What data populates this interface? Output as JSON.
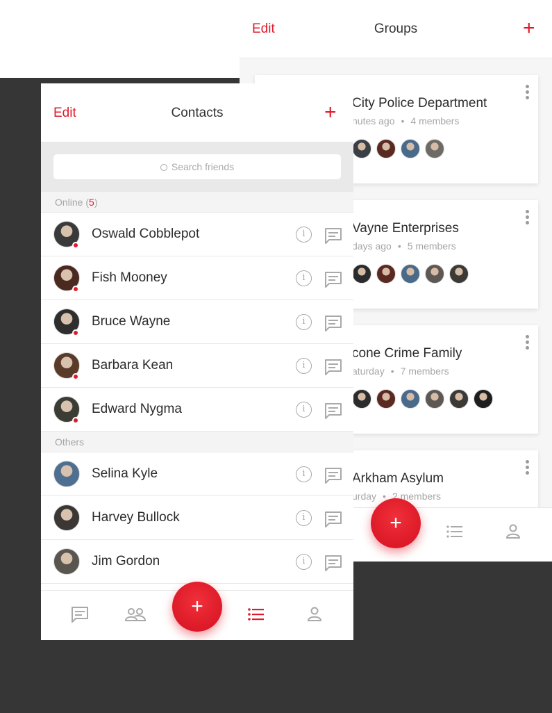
{
  "groups_screen": {
    "edit_label": "Edit",
    "title": "Groups",
    "add_label": "+",
    "groups": [
      {
        "name": "City Police Department",
        "time": "nutes ago",
        "members": "4 members",
        "avatar_colors": [
          "#3a3f46",
          "#5a2a22",
          "#4a6a8a",
          "#6e6b66"
        ]
      },
      {
        "name": "Vayne Enterprises",
        "time": "days ago",
        "members": "5 members",
        "avatar_colors": [
          "#2b2b2b",
          "#5a2a22",
          "#4a6a8a",
          "#5d5853",
          "#3b3a36"
        ]
      },
      {
        "name": "cone Crime Family",
        "time": "aturday",
        "members": "7 members",
        "avatar_colors": [
          "#2b2b2b",
          "#5a2a22",
          "#4a6a8a",
          "#5d5853",
          "#3b3a36",
          "#1e1e1e"
        ]
      },
      {
        "name": "Arkham Asylum",
        "time": "urday",
        "members": "2 members",
        "avatar_colors": []
      }
    ],
    "fab_label": "+"
  },
  "contacts_screen": {
    "edit_label": "Edit",
    "title": "Contacts",
    "add_label": "+",
    "search_placeholder": "Search friends",
    "online_label": "Online (",
    "online_count": "5",
    "online_close": ")",
    "others_label": "Others",
    "online": [
      {
        "name": "Oswald Cobblepot",
        "color": "#3a3a3a"
      },
      {
        "name": "Fish Mooney",
        "color": "#4a2a20"
      },
      {
        "name": "Bruce Wayne",
        "color": "#2e2e2e"
      },
      {
        "name": "Barbara Kean",
        "color": "#5a3a28"
      },
      {
        "name": "Edward Nygma",
        "color": "#3b3d35"
      }
    ],
    "others": [
      {
        "name": "Selina Kyle",
        "color": "#4e6f8f"
      },
      {
        "name": "Harvey Bullock",
        "color": "#3a3734"
      },
      {
        "name": "Jim Gordon",
        "color": "#59554f"
      }
    ],
    "info_glyph": "i",
    "fab_label": "+"
  },
  "colors": {
    "accent": "#e01a2b",
    "icon_gray": "#a9a9a9"
  },
  "icons": [
    "search-icon",
    "info-icon",
    "message-icon",
    "chat-tab-icon",
    "people-tab-icon",
    "list-tab-icon",
    "person-tab-icon",
    "kebab-icon",
    "plus-icon"
  ]
}
